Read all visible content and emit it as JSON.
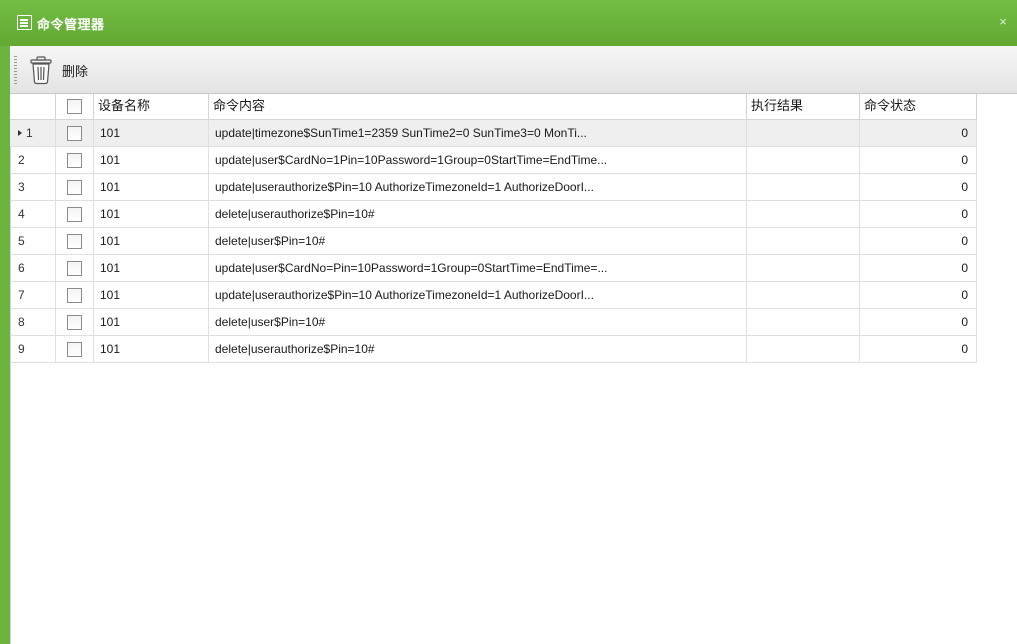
{
  "window": {
    "title": "命令管理器",
    "close_glyph": "×",
    "accent_color": "#6db33f"
  },
  "toolbar": {
    "delete_label": "删除",
    "delete_icon": "trash-icon"
  },
  "grid": {
    "columns": [
      "设备名称",
      "命令内容",
      "执行结果",
      "命令状态"
    ],
    "rows": [
      {
        "index": "1",
        "device": "101",
        "command": "update|timezone$SunTime1=2359   SunTime2=0   SunTime3=0   MonTi...",
        "result": "",
        "status": "0",
        "selected": true
      },
      {
        "index": "2",
        "device": "101",
        "command": "update|user$CardNo=1Pin=10Password=1Group=0StartTime=EndTime...",
        "result": "",
        "status": "0"
      },
      {
        "index": "3",
        "device": "101",
        "command": "update|userauthorize$Pin=10   AuthorizeTimezoneId=1   AuthorizeDoorI...",
        "result": "",
        "status": "0"
      },
      {
        "index": "4",
        "device": "101",
        "command": "delete|userauthorize$Pin=10#",
        "result": "",
        "status": "0"
      },
      {
        "index": "5",
        "device": "101",
        "command": "delete|user$Pin=10#",
        "result": "",
        "status": "0"
      },
      {
        "index": "6",
        "device": "101",
        "command": "update|user$CardNo=Pin=10Password=1Group=0StartTime=EndTime=...",
        "result": "",
        "status": "0"
      },
      {
        "index": "7",
        "device": "101",
        "command": "update|userauthorize$Pin=10   AuthorizeTimezoneId=1   AuthorizeDoorI...",
        "result": "",
        "status": "0"
      },
      {
        "index": "8",
        "device": "101",
        "command": "delete|user$Pin=10#",
        "result": "",
        "status": "0"
      },
      {
        "index": "9",
        "device": "101",
        "command": "delete|userauthorize$Pin=10#",
        "result": "",
        "status": "0"
      }
    ]
  }
}
